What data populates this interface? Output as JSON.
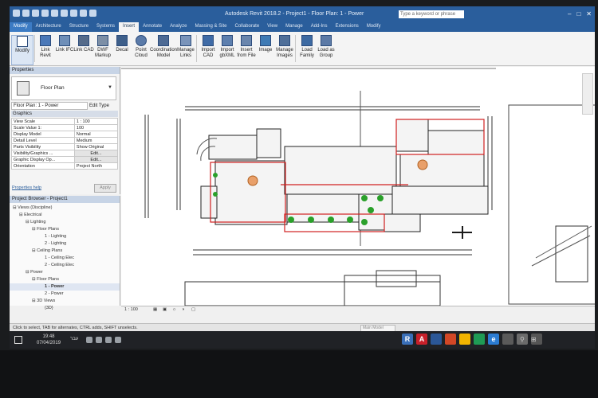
{
  "window": {
    "title": "Autodesk Revit 2018.2  -  Project1 - Floor Plan: 1 - Power",
    "search_placeholder": "Type a keyword or phrase"
  },
  "tabs": [
    "Modify",
    "Architecture",
    "Structure",
    "Systems",
    "Insert",
    "Annotate",
    "Analyze",
    "Massing & Site",
    "Collaborate",
    "View",
    "Manage",
    "Add-Ins",
    "Extensions",
    "Modify"
  ],
  "ribbon": {
    "buttons": [
      {
        "label": "Modify",
        "icon": "cursor-icon"
      },
      {
        "label": "Link Revit",
        "icon": "link-revit-icon"
      },
      {
        "label": "Link IFC",
        "icon": "link-ifc-icon"
      },
      {
        "label": "Link CAD",
        "icon": "link-cad-icon"
      },
      {
        "label": "DWF Markup",
        "icon": "dwf-icon"
      },
      {
        "label": "Decal",
        "icon": "decal-icon"
      },
      {
        "label": "Point Cloud",
        "icon": "point-cloud-icon"
      },
      {
        "label": "Coordination Model",
        "icon": "coordination-icon"
      },
      {
        "label": "Manage Links",
        "icon": "manage-links-icon"
      },
      {
        "label": "Import CAD",
        "icon": "import-cad-icon"
      },
      {
        "label": "Import gbXML",
        "icon": "gbxml-icon"
      },
      {
        "label": "Insert from File",
        "icon": "insert-file-icon"
      },
      {
        "label": "Image",
        "icon": "image-icon"
      },
      {
        "label": "Manage Images",
        "icon": "manage-images-icon"
      },
      {
        "label": "Load Family",
        "icon": "load-family-icon"
      },
      {
        "label": "Load as Group",
        "icon": "load-group-icon"
      }
    ]
  },
  "properties": {
    "header": "Properties",
    "type_name": "Floor Plan",
    "instance": "Floor Plan: 1 - Power",
    "edit_type": "Edit Type",
    "section": "Graphics",
    "rows": [
      {
        "name": "View Scale",
        "value": "1 : 100"
      },
      {
        "name": "Scale Value  1:",
        "value": "100"
      },
      {
        "name": "Display Model",
        "value": "Normal"
      },
      {
        "name": "Detail Level",
        "value": "Medium"
      },
      {
        "name": "Parts Visibility",
        "value": "Show Original"
      },
      {
        "name": "Visibility/Graphics ...",
        "value": "Edit..."
      },
      {
        "name": "Graphic Display Op...",
        "value": "Edit..."
      },
      {
        "name": "Orientation",
        "value": "Project North"
      }
    ],
    "help": "Properties help",
    "apply": "Apply"
  },
  "browser": {
    "header": "Project Browser - Project1",
    "items": [
      {
        "label": "Views (Discipline)"
      },
      {
        "label": "Electrical"
      },
      {
        "label": "Lighting"
      },
      {
        "label": "Floor Plans"
      },
      {
        "label": "1 - Lighting"
      },
      {
        "label": "2 - Lighting"
      },
      {
        "label": "Ceiling Plans"
      },
      {
        "label": "1 - Ceiling Elec"
      },
      {
        "label": "2 - Ceiling Elec"
      },
      {
        "label": "Power"
      },
      {
        "label": "Floor Plans"
      },
      {
        "label": "1 - Power"
      },
      {
        "label": "2 - Power"
      },
      {
        "label": "3D Views"
      },
      {
        "label": "{3D}"
      }
    ]
  },
  "view_control": {
    "scale": "1 : 100"
  },
  "status": {
    "text": "Click to select, TAB for alternates, CTRL adds, SHIFT unselects.",
    "main_model": "Main Model"
  },
  "taskbar": {
    "time": "19:48",
    "date": "07/04/2019",
    "lang": "עבר",
    "apps": [
      {
        "letter": "R",
        "color": "#3a6fb8"
      },
      {
        "letter": "A",
        "color": "#c8202a"
      },
      {
        "letter": "",
        "color": "#2b5797"
      },
      {
        "letter": "",
        "color": "#d24726"
      },
      {
        "letter": "",
        "color": "#f2b400"
      },
      {
        "letter": "",
        "color": "#1f9b55"
      },
      {
        "letter": "e",
        "color": "#2b7cd3"
      },
      {
        "letter": "",
        "color": "#5a5a5a"
      },
      {
        "letter": "",
        "color": "#6b6b6b"
      },
      {
        "letter": "",
        "color": "#555555"
      }
    ]
  }
}
